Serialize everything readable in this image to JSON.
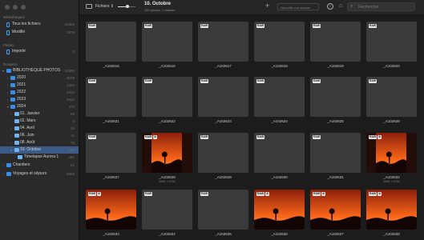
{
  "sidebar": {
    "sections": {
      "bibliotheques": "Bibliothèques",
      "flottes": "Flottes",
      "dossiers": "Dossiers"
    },
    "library_items": [
      {
        "label": "Tous les fichiers",
        "count": "10393"
      },
      {
        "label": "Modifié",
        "count": "1579"
      }
    ],
    "import_item": {
      "label": "Importé",
      "count": "0"
    },
    "root": {
      "label": "BIBLIOTHEQUE PHOTOS",
      "count": "10393"
    },
    "years": [
      {
        "label": "2020",
        "count": "3108"
      },
      {
        "label": "2021",
        "count": "1493"
      },
      {
        "label": "2022",
        "count": "2423"
      },
      {
        "label": "2023",
        "count": "3021"
      },
      {
        "label": "2024",
        "count": "473"
      }
    ],
    "months": [
      {
        "label": "01. Janvier",
        "count": "99"
      },
      {
        "label": "02. Mars",
        "count": "6"
      },
      {
        "label": "04. Avril",
        "count": "15"
      },
      {
        "label": "06. Juin",
        "count": "11"
      },
      {
        "label": "08. Août",
        "count": "70"
      },
      {
        "label": "10. Octobre",
        "count": "189"
      }
    ],
    "subfolder": {
      "label": "Timelapse Aurora 1",
      "count": "181"
    },
    "bottom": [
      {
        "label": "Chantiers",
        "count": "61"
      },
      {
        "label": "Voyages et séjours",
        "count": "5569"
      }
    ]
  },
  "toolbar": {
    "sort_label": "Fichiers",
    "sort_arrow": "⇕",
    "plus": "+",
    "info": "i",
    "tag": "⌂",
    "title": "10. Octobre",
    "subtitle": "189 photos, 1 dossier",
    "combo_placeholder": "Nouvelle vue dossier",
    "search_icon": "⌕",
    "search_placeholder": "Rechercher",
    "zoom_level": 0.55
  },
  "grid": {
    "tiles": [
      {
        "name": "_A102616",
        "badges": [
          "RAW"
        ],
        "image": false,
        "dims": ""
      },
      {
        "name": "_A102616",
        "badges": [
          "RAW"
        ],
        "image": false,
        "dims": ""
      },
      {
        "name": "_A102617",
        "badges": [
          "RAW"
        ],
        "image": false,
        "dims": ""
      },
      {
        "name": "_A102618",
        "badges": [
          "RAW"
        ],
        "image": false,
        "dims": ""
      },
      {
        "name": "_A102619",
        "badges": [
          "RAW"
        ],
        "image": false,
        "dims": ""
      },
      {
        "name": "_A102620",
        "badges": [
          "RAW"
        ],
        "image": false,
        "dims": ""
      },
      {
        "name": "_A102621",
        "badges": [
          "RAW"
        ],
        "image": false,
        "dims": ""
      },
      {
        "name": "_A102622",
        "badges": [
          "RAW"
        ],
        "image": false,
        "dims": ""
      },
      {
        "name": "_A102623",
        "badges": [
          "RAW"
        ],
        "image": false,
        "dims": ""
      },
      {
        "name": "_A102624",
        "badges": [
          "RAW"
        ],
        "image": false,
        "dims": ""
      },
      {
        "name": "_A102625",
        "badges": [
          "RAW"
        ],
        "image": false,
        "dims": ""
      },
      {
        "name": "_A102626",
        "badges": [
          "RAW"
        ],
        "image": false,
        "dims": ""
      },
      {
        "name": "_A102627",
        "badges": [
          "RAW"
        ],
        "image": false,
        "dims": ""
      },
      {
        "name": "_A102628",
        "badges": [
          "RAW",
          "⊘"
        ],
        "image": true,
        "dims": "3866 × 5784"
      },
      {
        "name": "_A102629",
        "badges": [
          "RAW"
        ],
        "image": false,
        "dims": ""
      },
      {
        "name": "_A102630",
        "badges": [
          "RAW"
        ],
        "image": false,
        "dims": ""
      },
      {
        "name": "_A102631",
        "badges": [
          "RAW"
        ],
        "image": false,
        "dims": ""
      },
      {
        "name": "_A102632",
        "badges": [
          "RAW",
          "⊘"
        ],
        "image": true,
        "dims": "3866 × 5784"
      },
      {
        "name": "_A102633",
        "badges": [
          "RAW",
          "⊘"
        ],
        "image": true,
        "dims": ""
      },
      {
        "name": "_A102634",
        "badges": [
          "RAW"
        ],
        "image": false,
        "dims": ""
      },
      {
        "name": "_A102635",
        "badges": [
          "RAW"
        ],
        "image": false,
        "dims": ""
      },
      {
        "name": "_A102636",
        "badges": [
          "RAW",
          "⊘"
        ],
        "image": true,
        "dims": ""
      },
      {
        "name": "_A102637",
        "badges": [
          "RAW",
          "⊘"
        ],
        "image": true,
        "dims": ""
      },
      {
        "name": "_A102638",
        "badges": [
          "RAW",
          "⊘"
        ],
        "image": true,
        "dims": ""
      }
    ]
  },
  "colors": {
    "accent": "#3b8ee8",
    "selection": "#3c5a86",
    "sky_top": "#8c1f0a",
    "sky_glow": "#ff6a1a",
    "ground": "#140505"
  }
}
